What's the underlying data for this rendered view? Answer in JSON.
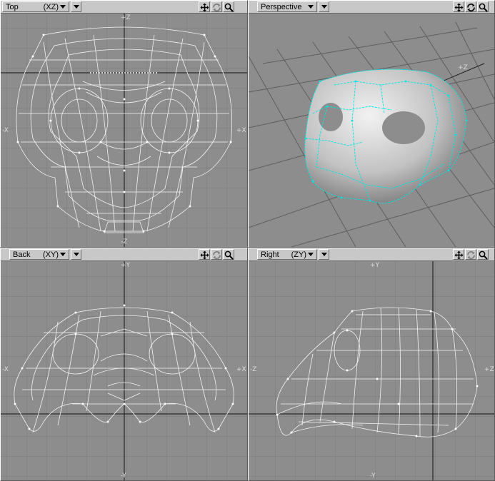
{
  "viewports": [
    {
      "id": "top",
      "view": "Top",
      "axes": "(XZ)",
      "labels": {
        "top": "+Z",
        "bottom": "-Z",
        "left": "-X",
        "right": "+X"
      }
    },
    {
      "id": "persp",
      "view": "Perspective",
      "axes": "",
      "labels": {
        "z": "+Z"
      }
    },
    {
      "id": "back",
      "view": "Back",
      "axes": "(XY)",
      "labels": {
        "top": "+Y",
        "bottom": "-Y",
        "left": "-X",
        "right": "+X"
      }
    },
    {
      "id": "right",
      "view": "Right",
      "axes": "(ZY)",
      "labels": {
        "top": "+Y",
        "bottom": "-Y",
        "left": "-Z",
        "right": "+Z"
      }
    }
  ],
  "icons": {
    "move": "four-arrow-move-icon",
    "rotate": "rotate-view-icon",
    "zoom": "magnifier-zoom-icon",
    "menu": "triangle-down-icon"
  },
  "colors": {
    "viewport_bg": "#8d8d8d",
    "grid": "#7a7a7a",
    "wire": "#ffffff",
    "selection": "#00e5e5",
    "panel": "#c8c8c8"
  }
}
